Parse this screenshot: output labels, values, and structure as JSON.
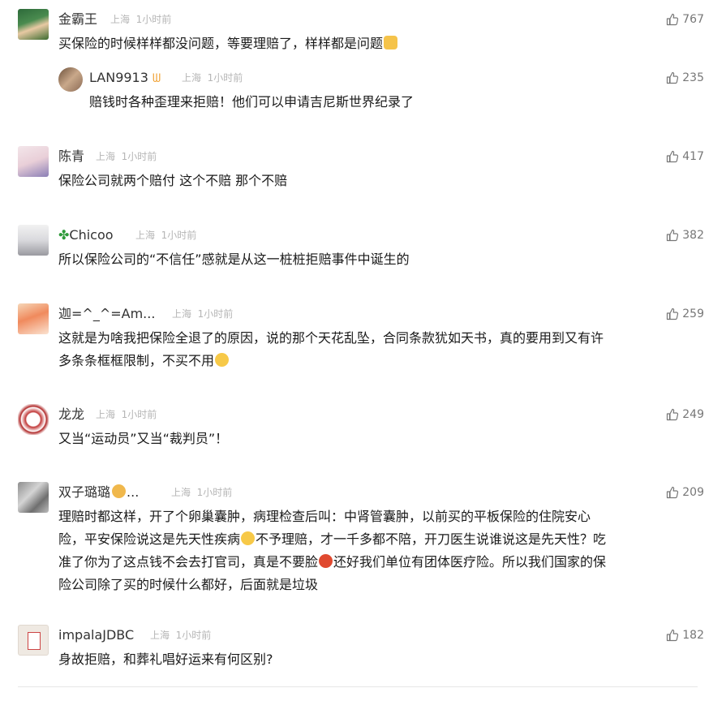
{
  "comments": [
    {
      "name": "金霸王",
      "loc": "上海",
      "time": "1小时前",
      "likes": "767",
      "text": "买保险的时候样样都没问题，等要理赔了，样样都是问题"
    },
    {
      "name": "LAN9913",
      "loc": "上海",
      "time": "1小时前",
      "likes": "235",
      "text": "赔钱时各种歪理来拒赔！他们可以申请吉尼斯世界纪录了"
    },
    {
      "name": "陈青",
      "loc": "上海",
      "time": "1小时前",
      "likes": "417",
      "text": "保险公司就两个赔付 这个不赔 那个不赔"
    },
    {
      "name": "Chicoo",
      "loc": "上海",
      "time": "1小时前",
      "likes": "382",
      "text": "所以保险公司的“不信任”感就是从这一桩桩拒赔事件中诞生的"
    },
    {
      "name": "迦=^_^=Am...",
      "loc": "上海",
      "time": "1小时前",
      "likes": "259",
      "text1": "这就是为啥我把保险全退了的原因，说的那个天花乱坠，合同条款犹如天书，真的要用到又有许",
      "text2": "多条条框框限制，不买不用"
    },
    {
      "name": "龙龙",
      "loc": "上海",
      "time": "1小时前",
      "likes": "249",
      "text": "又当“运动员”又当“裁判员”！"
    },
    {
      "name": "双子璐璐",
      "name_suffix": "...",
      "loc": "上海",
      "time": "1小时前",
      "likes": "209",
      "line1": "理赔时都这样，开了个卵巢囊肿，病理检查后叫：中肾管囊肿，以前买的平板保险的住院安心",
      "line2a": "险，平安保险说这是先天性疾病",
      "line2b": "不予理赔，才一千多都不陪，开刀医生说谁说这是先天性？吃",
      "line3a": "准了你为了这点钱不会去打官司，真是不要脸",
      "line3b": "还好我们单位有团体医疗险。所以我们国家的保",
      "line4": "险公司除了买的时候什么都好，后面就是垃圾"
    },
    {
      "name": "impalaJDBC",
      "loc": "上海",
      "time": "1小时前",
      "likes": "182",
      "text": "身故拒赔，和葬礼唱好运来有何区别?"
    }
  ]
}
